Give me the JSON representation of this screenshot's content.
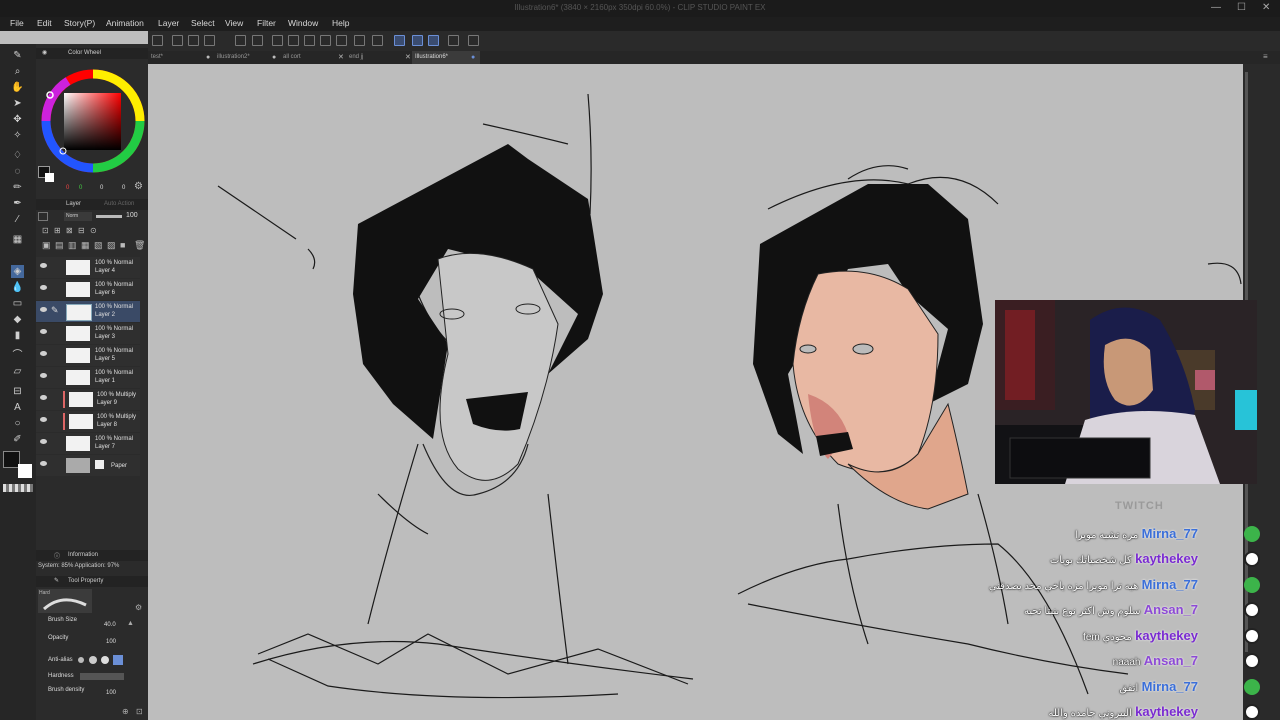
{
  "window": {
    "title": "Illustration6* (3840 × 2160px 350dpi 60.0%) - CLIP STUDIO PAINT EX"
  },
  "menu": [
    "File",
    "Edit",
    "Story(P)",
    "Animation",
    "Layer",
    "Select",
    "View",
    "Filter",
    "Window",
    "Help"
  ],
  "tabs": [
    {
      "label": "test*",
      "active": false
    },
    {
      "label": "illustration2*",
      "active": false
    },
    {
      "label": "all cort",
      "active": false
    },
    {
      "label": "end jj",
      "active": false
    },
    {
      "label": "Illustration6*",
      "active": true
    }
  ],
  "color_panel": {
    "title": "Color Wheel",
    "h": "0",
    "s": "0",
    "v": "0"
  },
  "layer_panel": {
    "tab_label": "Layer",
    "tab2_label": "Auto Action",
    "blend_mode": "Norm",
    "opacity": "100",
    "layers": [
      {
        "line1": "100 % Normal",
        "line2": "Layer 4",
        "clip": false
      },
      {
        "line1": "100 % Normal",
        "line2": "Layer 6",
        "clip": false
      },
      {
        "line1": "100 % Normal",
        "line2": "Layer 2",
        "clip": false,
        "selected": true
      },
      {
        "line1": "100 % Normal",
        "line2": "Layer 3",
        "clip": false
      },
      {
        "line1": "100 % Normal",
        "line2": "Layer 5",
        "clip": false
      },
      {
        "line1": "100 % Normal",
        "line2": "Layer 1",
        "clip": false
      },
      {
        "line1": "100 % Multiply",
        "line2": "Layer 9",
        "clip": true
      },
      {
        "line1": "100 % Multiply",
        "line2": "Layer 8",
        "clip": true
      },
      {
        "line1": "100 % Normal",
        "line2": "Layer 7",
        "clip": false
      },
      {
        "line1": "",
        "line2": "Paper",
        "clip": false
      }
    ]
  },
  "info_panel": {
    "title": "Information",
    "text": "System: 85%  Application: 97%"
  },
  "tool_property": {
    "title": "Tool Property",
    "preset": "Hard",
    "brush_size_label": "Brush Size",
    "brush_size": "40.0",
    "opacity_label": "Opacity",
    "opacity": "100",
    "antialias_label": "Anti-alias",
    "hardness_label": "Hardness",
    "density_label": "Brush density",
    "density": "100"
  },
  "chat": {
    "watermark": "TWITCH",
    "messages": [
      {
        "user": "Mirna_77",
        "text": "مره تشبه مويرا",
        "color": "#3b6fd9",
        "icon": "green"
      },
      {
        "user": "kaythekey",
        "text": "كل شخصياتك بويات",
        "color": "#7a2bd1",
        "icon": "user"
      },
      {
        "user": "Mirna_77",
        "text": "هيه ترا مويرا مزه ياخي محد يصدقني",
        "color": "#3b6fd9",
        "icon": "green"
      },
      {
        "user": "Ansan_7",
        "text": "سلوم وش اكثر نوع بنيتا تحبه",
        "color": "#8d4ad6",
        "icon": "user"
      },
      {
        "user": "kaythekey",
        "text": "fem محودي",
        "color": "#7a2bd1",
        "icon": "user"
      },
      {
        "user": "Ansan_7",
        "text": "naaah",
        "color": "#8d4ad6",
        "icon": "user"
      },
      {
        "user": "Mirna_77",
        "text": "اتفق",
        "color": "#3b6fd9",
        "icon": "green"
      },
      {
        "user": "kaythekey",
        "text": "البيروني جامده والله",
        "color": "#7a2bd1",
        "icon": "user"
      }
    ]
  },
  "colors": {
    "bg": "#bdbdbd",
    "ui_dark": "#262626",
    "accent": "#44689c"
  }
}
